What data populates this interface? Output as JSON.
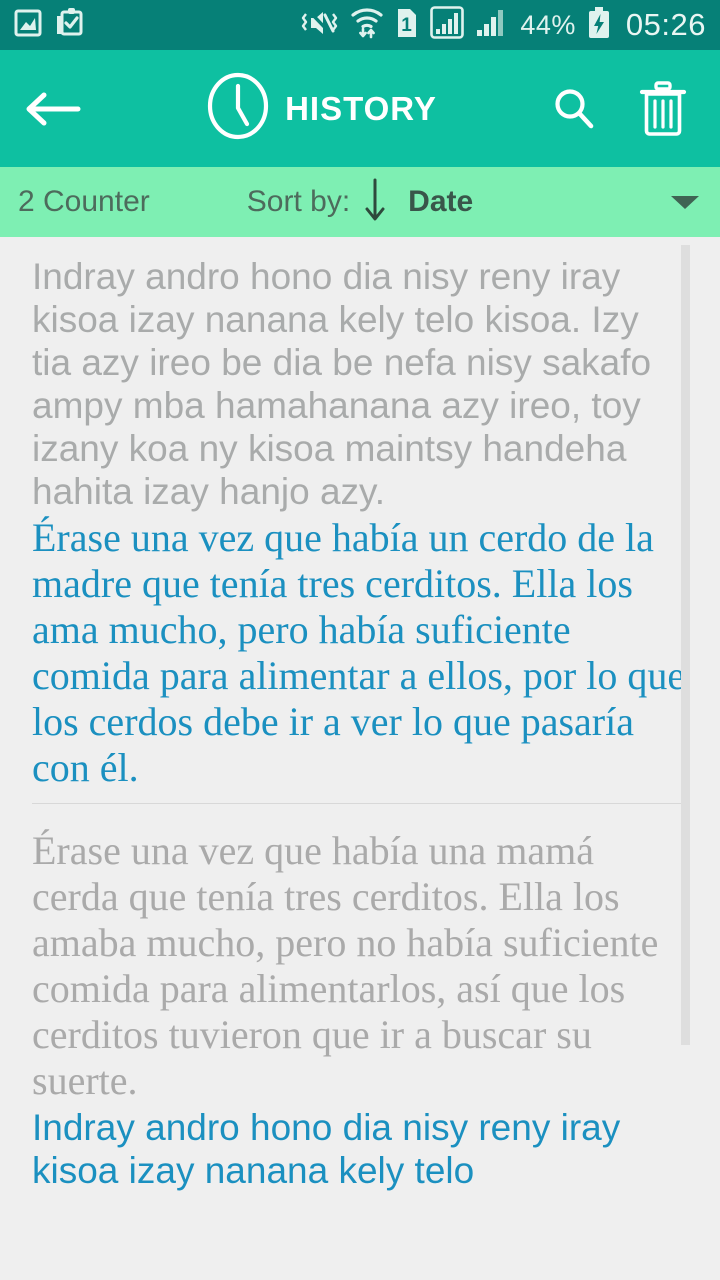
{
  "status_bar": {
    "icons_left": [
      "image-icon",
      "clipboard-check-icon"
    ],
    "icons_right": [
      "mute-vibrate-icon",
      "wifi-transfer-icon",
      "sim-1-icon",
      "signal-boxed-icon",
      "signal-bars-icon"
    ],
    "sim_label": "1",
    "battery_percent": "44%",
    "battery_state": "charging",
    "clock": "05:26",
    "background_color": "#068077",
    "foreground_color": "#dff2ee"
  },
  "toolbar": {
    "back_label": "back-arrow",
    "clock_icon": "clock-icon",
    "title": "HISTORY",
    "search_label": "search",
    "delete_label": "delete",
    "background_color": "#0ec0a1"
  },
  "sortbar": {
    "counter": "2 Counter",
    "sort_label": "Sort by:",
    "sort_direction": "descending",
    "sort_value": "Date",
    "caret": "dropdown-caret",
    "background_color": "#7eefb3"
  },
  "list": {
    "items": [
      {
        "source_text": "Indray andro hono dia nisy reny iray kisoa izay nanana kely telo kisoa. Izy tia azy ireo be dia be nefa nisy sakafo ampy mba hamahanana azy ireo, toy izany koa ny kisoa maintsy handeha hahita izay hanjo azy.",
        "translated_text": "Érase una vez que había un cerdo de la madre que tenía tres cerditos. Ella los ama mucho, pero había suficiente comida para alimentar a ellos, por lo que los cerdos debe ir a ver lo que pasaría con él.",
        "source_style": "sans-gray",
        "translated_style": "serif-blue"
      },
      {
        "source_text": "Érase una vez que había una mamá cerda que tenía tres cerditos. Ella los amaba mucho, pero no había suficiente comida para alimentarlos, así que los cerditos tuvieron que ir a buscar su suerte.",
        "translated_text": "Indray andro hono dia nisy reny iray kisoa izay nanana kely telo",
        "source_style": "serif-gray",
        "translated_style": "sans-blue"
      }
    ],
    "background_color": "#efefef",
    "scrollbar_color": "#dedede"
  }
}
